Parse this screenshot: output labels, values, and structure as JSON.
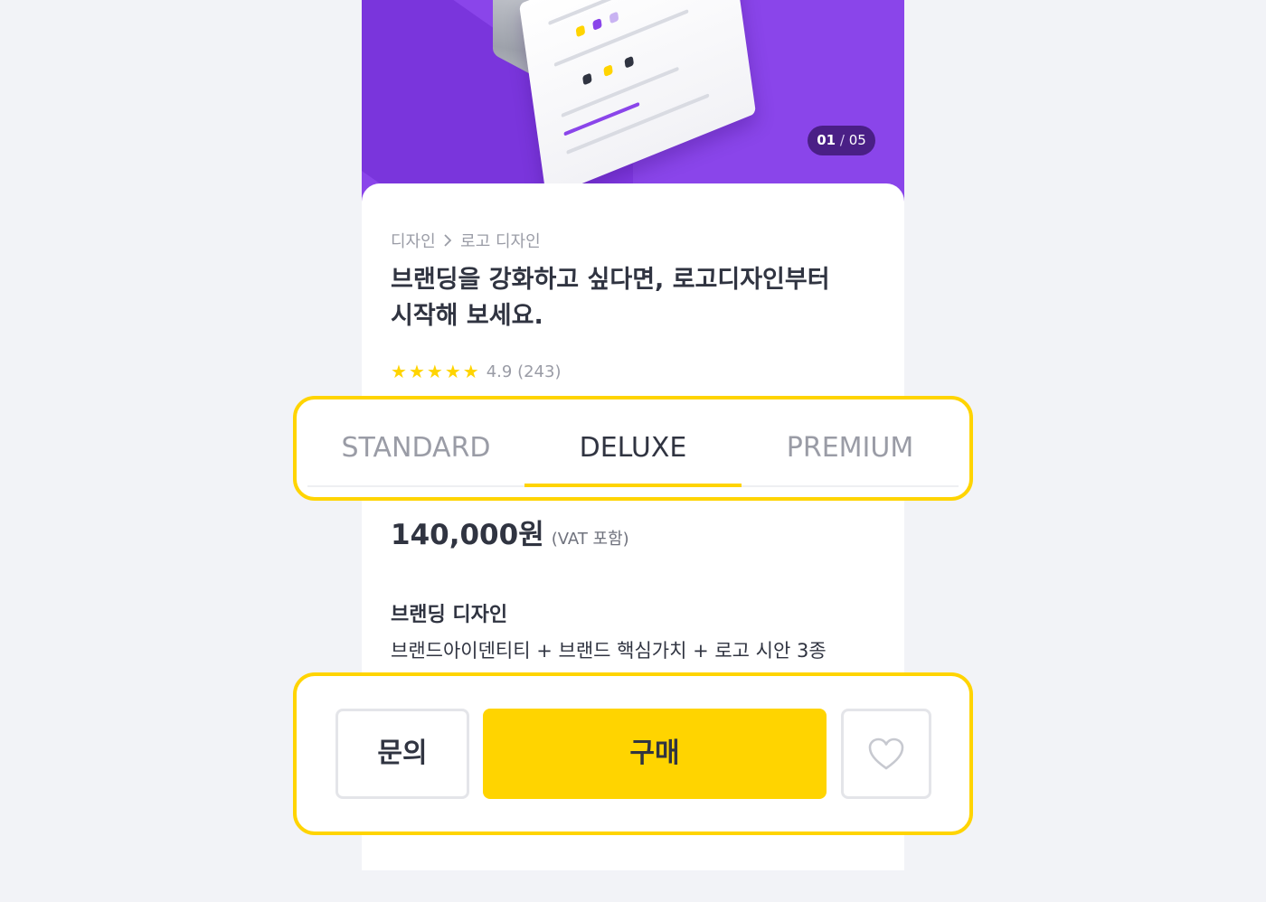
{
  "gallery": {
    "counter_current": "01",
    "counter_separator": "/",
    "counter_total": "05"
  },
  "product": {
    "breadcrumb": [
      "디자인",
      "로고 디자인"
    ],
    "title_line1": "브랜딩을 강화하고 싶다면, 로고디자인부터",
    "title_line2": "시작해 보세요.",
    "rating": "4.9",
    "review_count": "(243)",
    "stars": 5
  },
  "tabs": [
    {
      "label": "STANDARD",
      "active": false
    },
    {
      "label": "DELUXE",
      "active": true
    },
    {
      "label": "PREMIUM",
      "active": false
    }
  ],
  "package": {
    "price": "140,000원",
    "price_note": "(VAT 포함)",
    "name": "브랜딩 디자인",
    "description": "브랜드아이덴티티 + 브랜드 핵심가치 + 로고 시안 3종"
  },
  "actions": {
    "inquiry_label": "문의",
    "buy_label": "구매",
    "like_icon": "heart-outline-icon"
  },
  "colors": {
    "accent": "#ffd400",
    "hero_bg": "#8a45ea",
    "counter_bg": "#4a1f86",
    "text": "#303441",
    "muted": "#9a9ca6"
  }
}
